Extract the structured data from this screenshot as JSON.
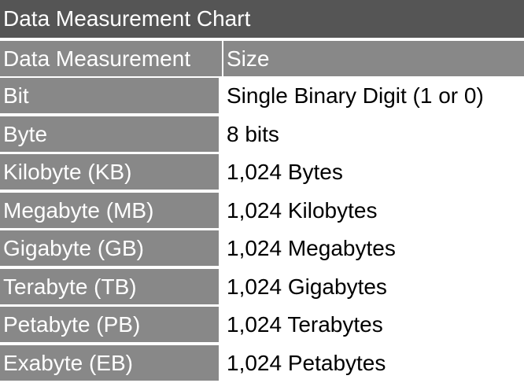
{
  "title": "Data Measurement Chart",
  "headers": {
    "measurement": "Data Measurement",
    "size": "Size"
  },
  "rows": [
    {
      "name": "Bit",
      "size": "Single Binary Digit (1 or 0)"
    },
    {
      "name": "Byte",
      "size": "8 bits"
    },
    {
      "name": "Kilobyte (KB)",
      "size": "1,024 Bytes"
    },
    {
      "name": "Megabyte (MB)",
      "size": "1,024 Kilobytes"
    },
    {
      "name": "Gigabyte (GB)",
      "size": "1,024 Megabytes"
    },
    {
      "name": "Terabyte (TB)",
      "size": "1,024 Gigabytes"
    },
    {
      "name": "Petabyte (PB)",
      "size": "1,024 Terabytes"
    },
    {
      "name": "Exabyte (EB)",
      "size": "1,024 Petabytes"
    }
  ],
  "colors": {
    "title_bg": "#555555",
    "label_bg": "#888888",
    "label_text": "#ffffff",
    "value_text": "#000000"
  }
}
